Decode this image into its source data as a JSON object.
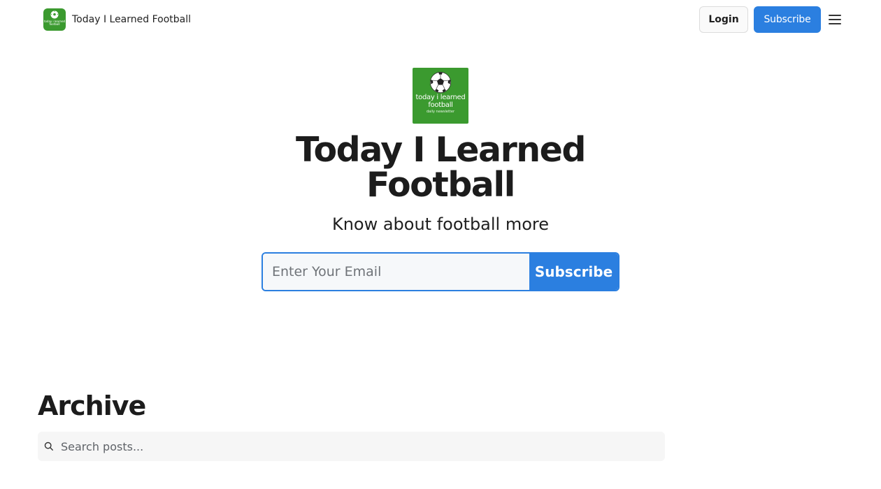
{
  "nav": {
    "brand_name": "Today I Learned Football",
    "brand_logo_text": "today i learned football",
    "login_label": "Login",
    "subscribe_label": "Subscribe",
    "menu_icon": "hamburger-menu-icon"
  },
  "hero": {
    "logo_line1": "today i learned football",
    "logo_line2": "daily newsletter",
    "logo_icon": "soccer-ball-icon",
    "title": "Today I Learned Football",
    "subtitle": "Know about football more",
    "email_placeholder": "Enter Your Email",
    "subscribe_label": "Subscribe"
  },
  "archive": {
    "title": "Archive",
    "search_placeholder": "Search posts...",
    "search_icon": "search-icon"
  },
  "colors": {
    "accent": "#2b7fe0",
    "logo_green": "#3b9a2f"
  }
}
